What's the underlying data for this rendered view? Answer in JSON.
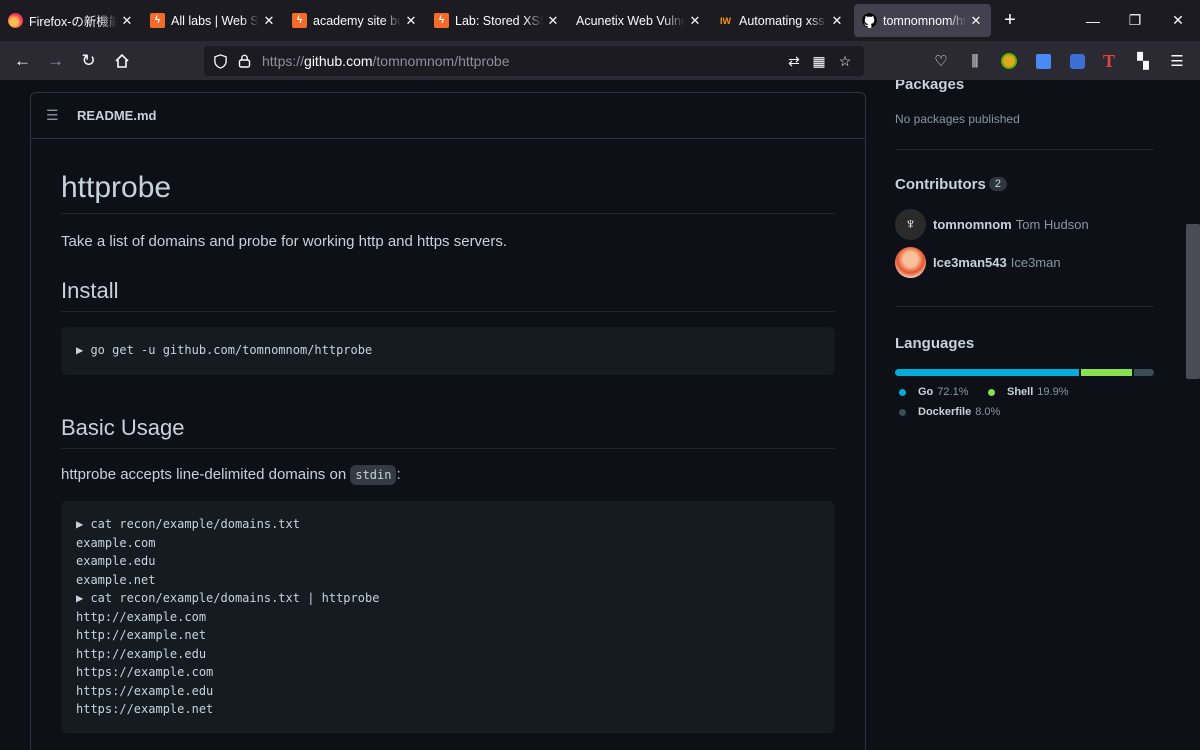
{
  "tabs": [
    {
      "title": "Firefox-の新機能 -",
      "favicon": "firefox-icon"
    },
    {
      "title": "All labs | Web Sec",
      "favicon": "portswigger-icon"
    },
    {
      "title": "academy site bug",
      "favicon": "portswigger-icon"
    },
    {
      "title": "Lab: Stored XSS in",
      "favicon": "portswigger-icon"
    },
    {
      "title": "Acunetix Web Vulnera",
      "favicon": "none"
    },
    {
      "title": "Automating xss ic",
      "favicon": "iw-icon",
      "favicon_text": "IW"
    },
    {
      "title": "tomnomnom/httprobe",
      "favicon": "github-icon",
      "active": true
    }
  ],
  "url": {
    "prefix": "https://",
    "host": "github.com",
    "path": "/tomnomnom/httprobe"
  },
  "readme": {
    "filename": "README.md",
    "title": "httprobe",
    "intro": "Take a list of domains and probe for working http and https servers.",
    "install_heading": "Install",
    "install_code": [
      "▶ go get -u github.com/tomnomnom/httprobe"
    ],
    "usage_heading": "Basic Usage",
    "usage_text_before": "httprobe accepts line-delimited domains on ",
    "usage_code_inline": "stdin",
    "usage_text_after": ":",
    "usage_code": [
      "▶ cat recon/example/domains.txt",
      "example.com",
      "example.edu",
      "example.net",
      "▶ cat recon/example/domains.txt | httprobe",
      "http://example.com",
      "http://example.net",
      "http://example.edu",
      "https://example.com",
      "https://example.edu",
      "https://example.net"
    ]
  },
  "sidebar": {
    "packages_heading": "Packages",
    "packages_text": "No packages published",
    "contributors_heading": "Contributors",
    "contributors_count": "2",
    "contributors": [
      {
        "login": "tomnomnom",
        "name": "Tom Hudson"
      },
      {
        "login": "Ice3man543",
        "name": "Ice3man"
      }
    ],
    "languages_heading": "Languages",
    "languages": [
      {
        "name": "Go",
        "pct": "72.1%",
        "value": 72.1,
        "color": "#00add8"
      },
      {
        "name": "Shell",
        "pct": "19.9%",
        "value": 19.9,
        "color": "#89e051"
      },
      {
        "name": "Dockerfile",
        "pct": "8.0%",
        "value": 8.0,
        "color": "#384d54"
      }
    ]
  },
  "colors": {
    "accent": "#58a6ff",
    "bg": "#0d1117"
  }
}
